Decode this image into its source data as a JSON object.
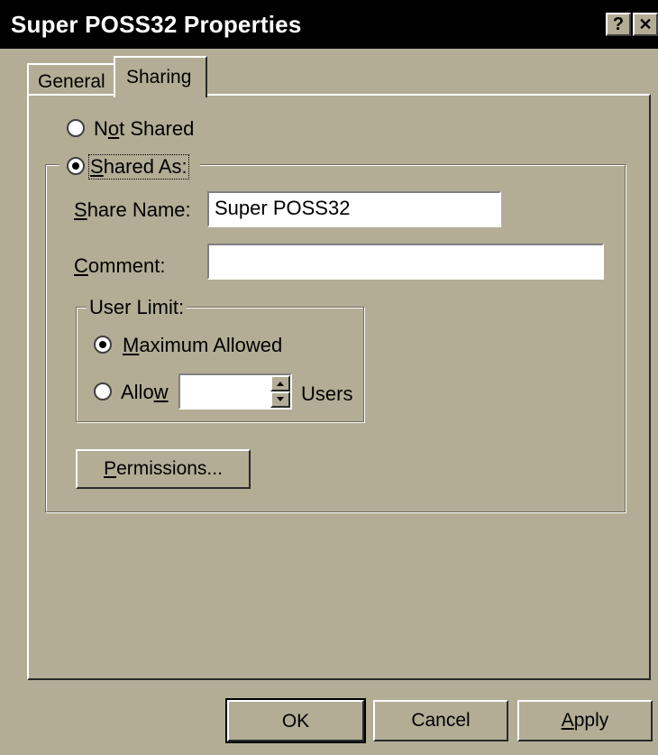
{
  "window": {
    "title": "Super POSS32 Properties",
    "help_glyph": "?",
    "close_glyph": "✕"
  },
  "tabs": [
    {
      "label": "General",
      "active": false
    },
    {
      "label": "Sharing",
      "active": true
    }
  ],
  "sharing": {
    "not_shared": {
      "pre": "N",
      "accel": "o",
      "post": "t Shared",
      "selected": false
    },
    "shared_as": {
      "accel": "S",
      "post": "hared As:",
      "selected": true
    },
    "share_name": {
      "accel": "S",
      "post": "hare Name:",
      "value": "Super POSS32"
    },
    "comment": {
      "accel": "C",
      "post": "omment:",
      "value": ""
    },
    "user_limit": {
      "legend": "User Limit:",
      "maximum": {
        "accel": "M",
        "post": "aximum Allowed",
        "selected": true
      },
      "allow": {
        "pre": "Allo",
        "accel": "w",
        "selected": false,
        "value": ""
      },
      "users_label": "Users"
    },
    "permissions": {
      "accel": "P",
      "post": "ermissions..."
    }
  },
  "buttons": {
    "ok": "OK",
    "cancel": "Cancel",
    "apply": {
      "accel": "A",
      "post": "pply"
    }
  }
}
